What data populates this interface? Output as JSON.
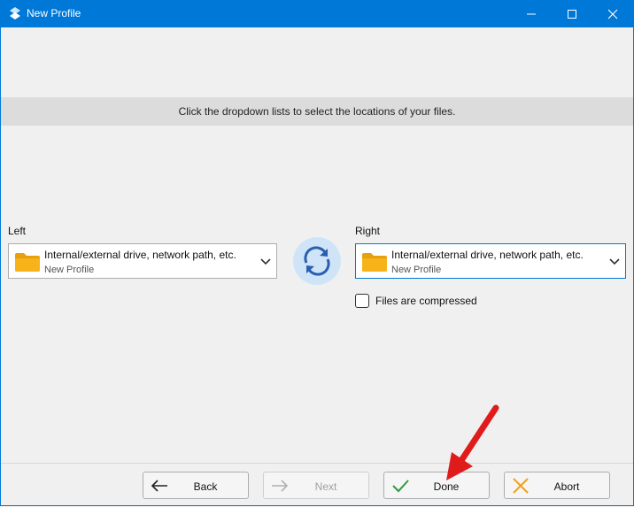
{
  "window": {
    "title": "New Profile",
    "icon": "app-logo-icon",
    "controls": [
      "minimize-icon",
      "maximize-icon",
      "close-icon"
    ]
  },
  "hint": "Click the dropdown lists to select the locations of your files.",
  "left": {
    "label": "Left",
    "selected_main": "Internal/external drive, network path, etc.",
    "selected_sub": "New Profile",
    "icon": "folder-icon"
  },
  "right": {
    "label": "Right",
    "selected_main": "Internal/external drive, network path, etc.",
    "selected_sub": "New Profile",
    "icon": "folder-icon"
  },
  "swap": {
    "icon": "swap-arrows-icon"
  },
  "options": {
    "compressed_label": "Files are compressed",
    "compressed_checked": false
  },
  "buttons": {
    "back": "Back",
    "next": "Next",
    "done": "Done",
    "abort": "Abort"
  },
  "colors": {
    "titlebar": "#0078d7",
    "folder": "#f6b41a",
    "done_check": "#2e9a3a",
    "abort_x": "#f0a020",
    "annotation": "#e01b1b"
  }
}
